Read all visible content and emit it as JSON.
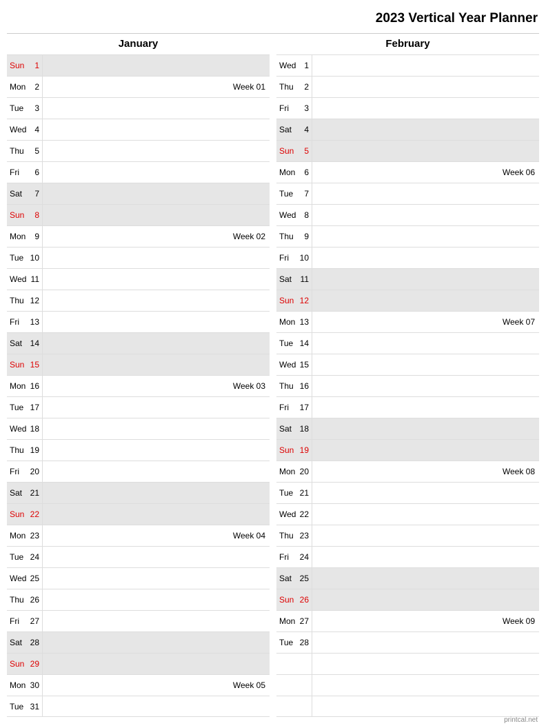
{
  "title": "2023 Vertical Year Planner",
  "footer": "printcal.net",
  "months": [
    {
      "name": "January",
      "days": [
        {
          "dow": "Sun",
          "num": "1",
          "note": "",
          "weekend": true,
          "sunday": true
        },
        {
          "dow": "Mon",
          "num": "2",
          "note": "Week 01",
          "weekend": false,
          "sunday": false
        },
        {
          "dow": "Tue",
          "num": "3",
          "note": "",
          "weekend": false,
          "sunday": false
        },
        {
          "dow": "Wed",
          "num": "4",
          "note": "",
          "weekend": false,
          "sunday": false
        },
        {
          "dow": "Thu",
          "num": "5",
          "note": "",
          "weekend": false,
          "sunday": false
        },
        {
          "dow": "Fri",
          "num": "6",
          "note": "",
          "weekend": false,
          "sunday": false
        },
        {
          "dow": "Sat",
          "num": "7",
          "note": "",
          "weekend": true,
          "sunday": false
        },
        {
          "dow": "Sun",
          "num": "8",
          "note": "",
          "weekend": true,
          "sunday": true
        },
        {
          "dow": "Mon",
          "num": "9",
          "note": "Week 02",
          "weekend": false,
          "sunday": false
        },
        {
          "dow": "Tue",
          "num": "10",
          "note": "",
          "weekend": false,
          "sunday": false
        },
        {
          "dow": "Wed",
          "num": "11",
          "note": "",
          "weekend": false,
          "sunday": false
        },
        {
          "dow": "Thu",
          "num": "12",
          "note": "",
          "weekend": false,
          "sunday": false
        },
        {
          "dow": "Fri",
          "num": "13",
          "note": "",
          "weekend": false,
          "sunday": false
        },
        {
          "dow": "Sat",
          "num": "14",
          "note": "",
          "weekend": true,
          "sunday": false
        },
        {
          "dow": "Sun",
          "num": "15",
          "note": "",
          "weekend": true,
          "sunday": true
        },
        {
          "dow": "Mon",
          "num": "16",
          "note": "Week 03",
          "weekend": false,
          "sunday": false
        },
        {
          "dow": "Tue",
          "num": "17",
          "note": "",
          "weekend": false,
          "sunday": false
        },
        {
          "dow": "Wed",
          "num": "18",
          "note": "",
          "weekend": false,
          "sunday": false
        },
        {
          "dow": "Thu",
          "num": "19",
          "note": "",
          "weekend": false,
          "sunday": false
        },
        {
          "dow": "Fri",
          "num": "20",
          "note": "",
          "weekend": false,
          "sunday": false
        },
        {
          "dow": "Sat",
          "num": "21",
          "note": "",
          "weekend": true,
          "sunday": false
        },
        {
          "dow": "Sun",
          "num": "22",
          "note": "",
          "weekend": true,
          "sunday": true
        },
        {
          "dow": "Mon",
          "num": "23",
          "note": "Week 04",
          "weekend": false,
          "sunday": false
        },
        {
          "dow": "Tue",
          "num": "24",
          "note": "",
          "weekend": false,
          "sunday": false
        },
        {
          "dow": "Wed",
          "num": "25",
          "note": "",
          "weekend": false,
          "sunday": false
        },
        {
          "dow": "Thu",
          "num": "26",
          "note": "",
          "weekend": false,
          "sunday": false
        },
        {
          "dow": "Fri",
          "num": "27",
          "note": "",
          "weekend": false,
          "sunday": false
        },
        {
          "dow": "Sat",
          "num": "28",
          "note": "",
          "weekend": true,
          "sunday": false
        },
        {
          "dow": "Sun",
          "num": "29",
          "note": "",
          "weekend": true,
          "sunday": true
        },
        {
          "dow": "Mon",
          "num": "30",
          "note": "Week 05",
          "weekend": false,
          "sunday": false
        },
        {
          "dow": "Tue",
          "num": "31",
          "note": "",
          "weekend": false,
          "sunday": false
        }
      ]
    },
    {
      "name": "February",
      "days": [
        {
          "dow": "Wed",
          "num": "1",
          "note": "",
          "weekend": false,
          "sunday": false
        },
        {
          "dow": "Thu",
          "num": "2",
          "note": "",
          "weekend": false,
          "sunday": false
        },
        {
          "dow": "Fri",
          "num": "3",
          "note": "",
          "weekend": false,
          "sunday": false
        },
        {
          "dow": "Sat",
          "num": "4",
          "note": "",
          "weekend": true,
          "sunday": false
        },
        {
          "dow": "Sun",
          "num": "5",
          "note": "",
          "weekend": true,
          "sunday": true
        },
        {
          "dow": "Mon",
          "num": "6",
          "note": "Week 06",
          "weekend": false,
          "sunday": false
        },
        {
          "dow": "Tue",
          "num": "7",
          "note": "",
          "weekend": false,
          "sunday": false
        },
        {
          "dow": "Wed",
          "num": "8",
          "note": "",
          "weekend": false,
          "sunday": false
        },
        {
          "dow": "Thu",
          "num": "9",
          "note": "",
          "weekend": false,
          "sunday": false
        },
        {
          "dow": "Fri",
          "num": "10",
          "note": "",
          "weekend": false,
          "sunday": false
        },
        {
          "dow": "Sat",
          "num": "11",
          "note": "",
          "weekend": true,
          "sunday": false
        },
        {
          "dow": "Sun",
          "num": "12",
          "note": "",
          "weekend": true,
          "sunday": true
        },
        {
          "dow": "Mon",
          "num": "13",
          "note": "Week 07",
          "weekend": false,
          "sunday": false
        },
        {
          "dow": "Tue",
          "num": "14",
          "note": "",
          "weekend": false,
          "sunday": false
        },
        {
          "dow": "Wed",
          "num": "15",
          "note": "",
          "weekend": false,
          "sunday": false
        },
        {
          "dow": "Thu",
          "num": "16",
          "note": "",
          "weekend": false,
          "sunday": false
        },
        {
          "dow": "Fri",
          "num": "17",
          "note": "",
          "weekend": false,
          "sunday": false
        },
        {
          "dow": "Sat",
          "num": "18",
          "note": "",
          "weekend": true,
          "sunday": false
        },
        {
          "dow": "Sun",
          "num": "19",
          "note": "",
          "weekend": true,
          "sunday": true
        },
        {
          "dow": "Mon",
          "num": "20",
          "note": "Week 08",
          "weekend": false,
          "sunday": false
        },
        {
          "dow": "Tue",
          "num": "21",
          "note": "",
          "weekend": false,
          "sunday": false
        },
        {
          "dow": "Wed",
          "num": "22",
          "note": "",
          "weekend": false,
          "sunday": false
        },
        {
          "dow": "Thu",
          "num": "23",
          "note": "",
          "weekend": false,
          "sunday": false
        },
        {
          "dow": "Fri",
          "num": "24",
          "note": "",
          "weekend": false,
          "sunday": false
        },
        {
          "dow": "Sat",
          "num": "25",
          "note": "",
          "weekend": true,
          "sunday": false
        },
        {
          "dow": "Sun",
          "num": "26",
          "note": "",
          "weekend": true,
          "sunday": true
        },
        {
          "dow": "Mon",
          "num": "27",
          "note": "Week 09",
          "weekend": false,
          "sunday": false
        },
        {
          "dow": "Tue",
          "num": "28",
          "note": "",
          "weekend": false,
          "sunday": false
        },
        {
          "dow": "",
          "num": "",
          "note": "",
          "weekend": false,
          "sunday": false,
          "empty": true
        },
        {
          "dow": "",
          "num": "",
          "note": "",
          "weekend": false,
          "sunday": false,
          "empty": true
        },
        {
          "dow": "",
          "num": "",
          "note": "",
          "weekend": false,
          "sunday": false,
          "empty": true
        }
      ]
    }
  ]
}
